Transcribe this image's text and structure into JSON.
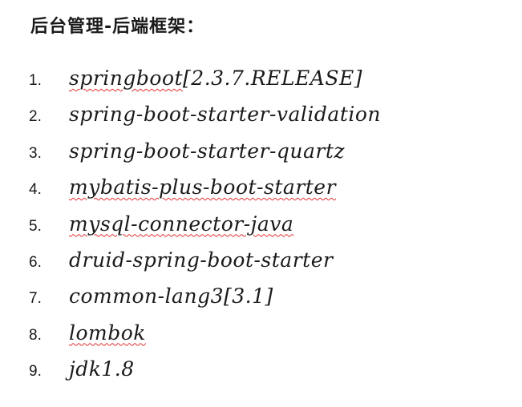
{
  "document": {
    "heading": "后台管理-后端框架：",
    "items": [
      {
        "number": "1.",
        "text": "springboot[2.3.7.RELEASE]",
        "spell_word": "springboot",
        "rest": "[2.3.7.RELEASE]"
      },
      {
        "number": "2.",
        "text": "spring-boot-starter-validation",
        "spell_word": "",
        "rest": "spring-boot-starter-validation"
      },
      {
        "number": "3.",
        "text": "spring-boot-starter-quartz",
        "spell_word": "",
        "rest": "spring-boot-starter-quartz"
      },
      {
        "number": "4.",
        "text": "mybatis-plus-boot-starter",
        "spell_word": "mybatis-plus-boot-starter",
        "rest": ""
      },
      {
        "number": "5.",
        "text": "mysql-connector-java",
        "spell_word": "mysql-connector-java",
        "rest": ""
      },
      {
        "number": "6.",
        "text": "druid-spring-boot-starter",
        "spell_word": "",
        "rest": "druid-spring-boot-starter"
      },
      {
        "number": "7.",
        "text": "common-lang3[3.1]",
        "spell_word": "",
        "rest": "common-lang3[3.1]"
      },
      {
        "number": "8.",
        "text": "lombok",
        "spell_word": "lombok",
        "rest": ""
      },
      {
        "number": "9.",
        "text": "jdk1.8",
        "spell_word": "",
        "rest": "jdk1.8"
      }
    ]
  },
  "colors": {
    "spellcheck_underline": "#e03030",
    "text": "#1a1a1a",
    "background": "#ffffff"
  }
}
